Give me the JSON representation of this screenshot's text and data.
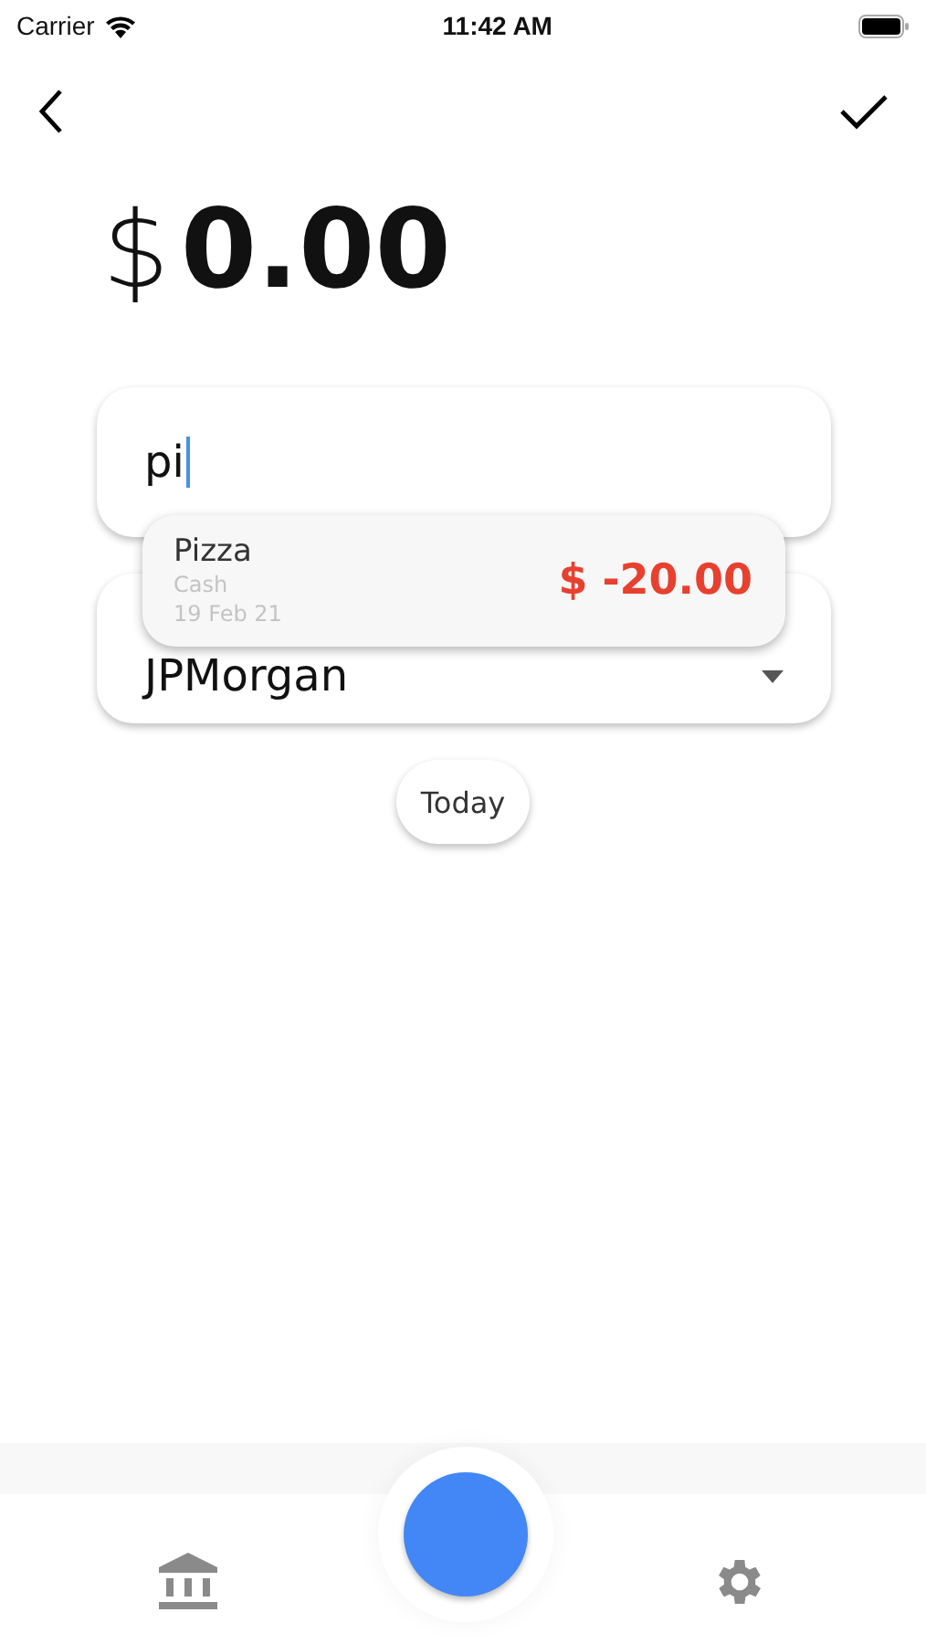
{
  "status_bar": {
    "carrier": "Carrier",
    "time": "11:42 AM"
  },
  "amount": {
    "currency": "$",
    "value": "0.00"
  },
  "name_field": {
    "value": "pi",
    "focused": true
  },
  "suggestion": {
    "title": "Pizza",
    "account": "Cash",
    "date": "19 Feb 21",
    "amount": "$ -20.00"
  },
  "account_field": {
    "value": "JPMorgan"
  },
  "date_button": {
    "label": "Today"
  },
  "bottom_nav": [
    {
      "kind": "bank"
    },
    {
      "kind": "add"
    },
    {
      "kind": "settings"
    }
  ]
}
